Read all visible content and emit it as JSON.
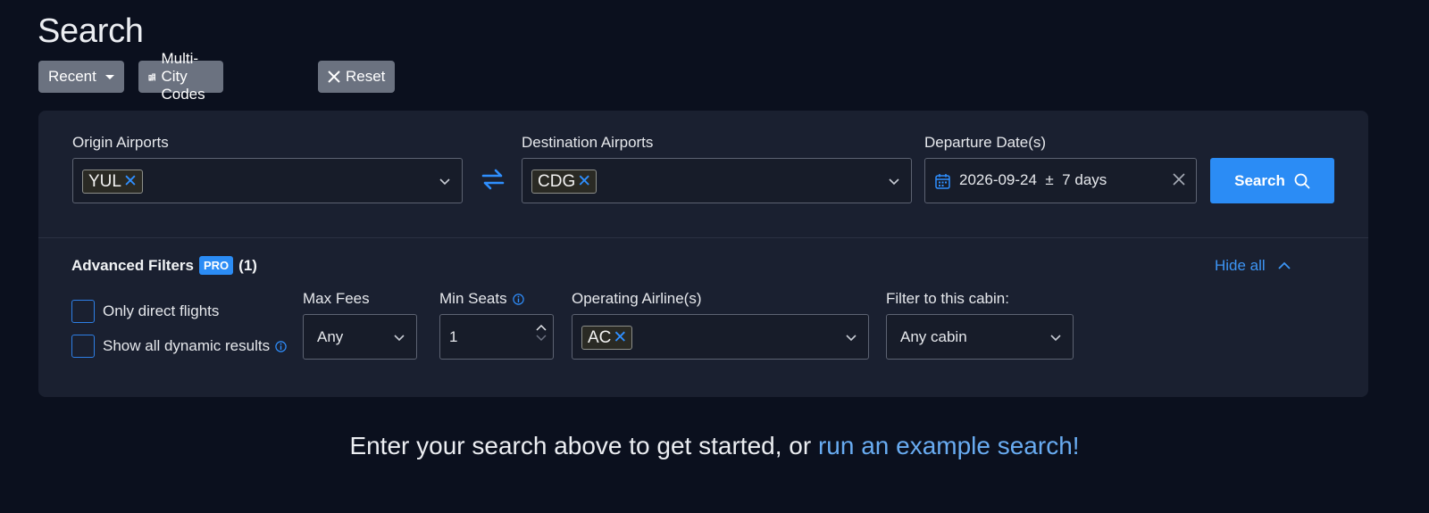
{
  "page": {
    "title": "Search"
  },
  "toolbar": {
    "recent_label": "Recent",
    "multicity_label": "Multi-City Codes",
    "reset_label": "Reset"
  },
  "search": {
    "origin_label": "Origin Airports",
    "origin_chips": [
      "YUL"
    ],
    "destination_label": "Destination Airports",
    "destination_chips": [
      "CDG"
    ],
    "departure_label": "Departure Date(s)",
    "departure_value": "2026-09-24  ±  7 days",
    "search_button": "Search"
  },
  "advanced": {
    "title": "Advanced Filters",
    "badge": "PRO",
    "count": "(1)",
    "hide_all": "Hide all",
    "only_direct_label": "Only direct flights",
    "only_direct_checked": false,
    "dynamic_label": "Show all dynamic results",
    "dynamic_checked": false,
    "max_fees_label": "Max Fees",
    "max_fees_value": "Any",
    "min_seats_label": "Min Seats",
    "min_seats_value": "1",
    "airline_label": "Operating Airline(s)",
    "airline_chips": [
      "AC"
    ],
    "cabin_label": "Filter to this cabin:",
    "cabin_value": "Any cabin"
  },
  "cta": {
    "prefix": "Enter your search above to get started, or ",
    "link": "run an example search!"
  },
  "colors": {
    "background": "#0b101e",
    "panel": "#1a2030",
    "accent": "#2b8cf5",
    "link": "#69acf2"
  }
}
